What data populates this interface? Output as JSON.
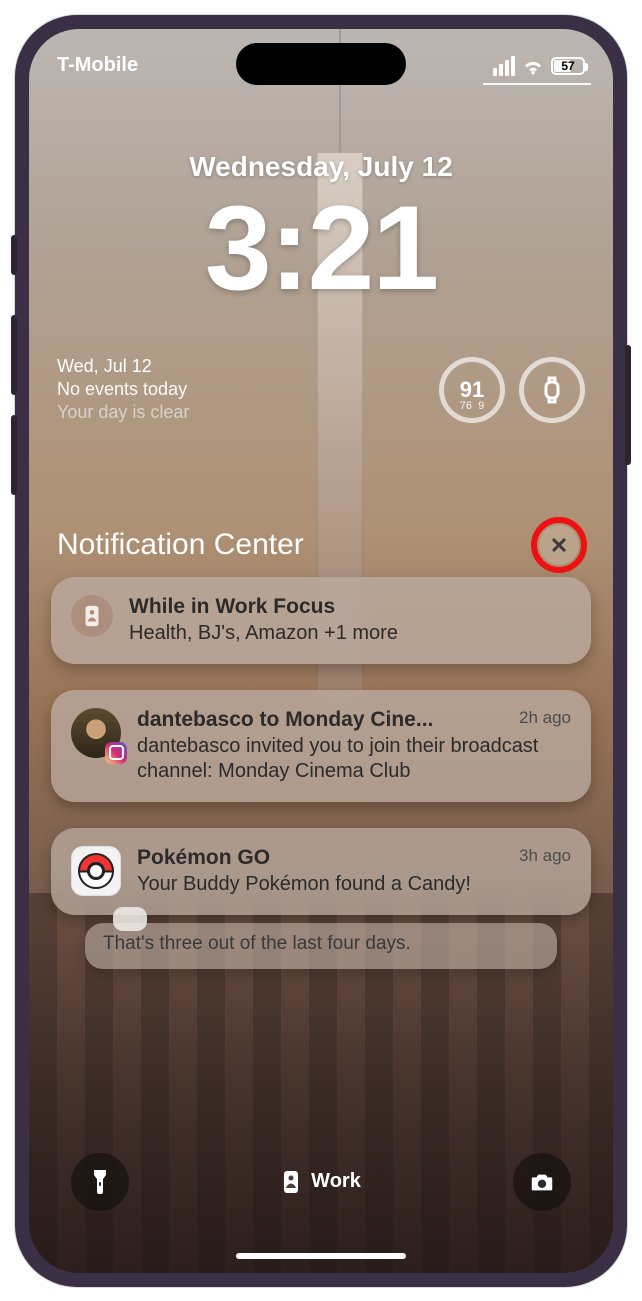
{
  "status": {
    "carrier": "T-Mobile",
    "battery_pct": "57"
  },
  "lock": {
    "date": "Wednesday, July 12",
    "time": "3:21"
  },
  "widgets": {
    "calendar": {
      "line1": "Wed, Jul 12",
      "line2": "No events today",
      "line3": "Your day is clear"
    },
    "weather": {
      "temp": "91",
      "low": "76",
      "high": "9"
    }
  },
  "nc": {
    "title": "Notification Center"
  },
  "notifications": {
    "focus": {
      "title": "While in Work Focus",
      "body": "Health, BJ's, Amazon +1 more"
    },
    "n1": {
      "title": "dantebasco to Monday Cine...",
      "time": "2h ago",
      "body": "dantebasco invited you to join their broadcast channel: Monday Cinema Club"
    },
    "n2": {
      "title": "Pokémon GO",
      "time": "3h ago",
      "body": "Your Buddy Pokémon found a Candy!"
    },
    "peek": {
      "body": "That's three out of the last four days."
    }
  },
  "dock": {
    "focus_label": "Work"
  }
}
